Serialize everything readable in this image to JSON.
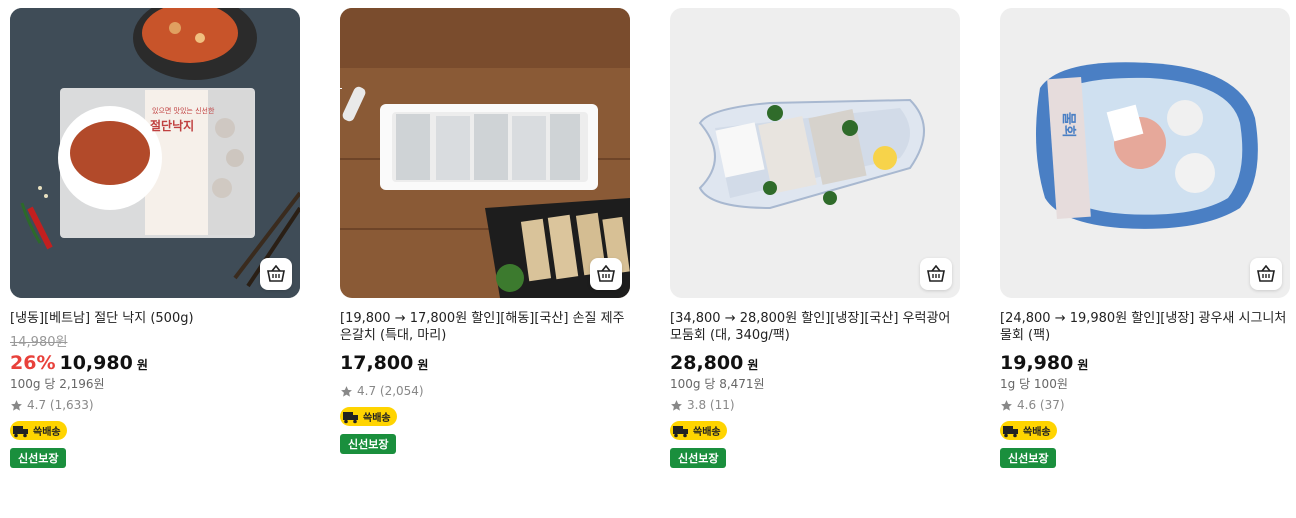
{
  "products": [
    {
      "title": "[냉동][베트남] 절단 낙지 (500g)",
      "original_price": "14,980원",
      "discount": "26%",
      "price": "10,980",
      "currency": "원",
      "unit_price": "100g 당 2,196원",
      "rating": "4.7 (1,633)",
      "delivery_badge": "쓱배송",
      "fresh_badge": "신선보장",
      "package_title": "절단낙지",
      "package_subtitle": "있으면 맛있는 신선한"
    },
    {
      "title": "[19,800 → 17,800원 할인][해동][국산] 손질 제주 은갈치 (특대, 마리)",
      "price": "17,800",
      "currency": "원",
      "rating": "4.7 (2,054)",
      "delivery_badge": "쓱배송",
      "fresh_badge": "신선보장"
    },
    {
      "title": "[34,800 → 28,800원 할인][냉장][국산] 우럭광어모둠회 (대, 340g/팩)",
      "price": "28,800",
      "currency": "원",
      "unit_price": "100g 당 8,471원",
      "rating": "3.8 (11)",
      "delivery_badge": "쓱배송",
      "fresh_badge": "신선보장"
    },
    {
      "title": "[24,800 → 19,980원 할인][냉장] 광우새 시그니처 물회 (팩)",
      "price": "19,980",
      "currency": "원",
      "unit_price": "1g 당 100원",
      "rating": "4.6 (37)",
      "delivery_badge": "쓱배송",
      "fresh_badge": "신선보장",
      "package_label": "물회"
    }
  ],
  "icons": {
    "cart": "basket-icon",
    "star": "star-icon",
    "truck": "delivery-truck-icon"
  }
}
